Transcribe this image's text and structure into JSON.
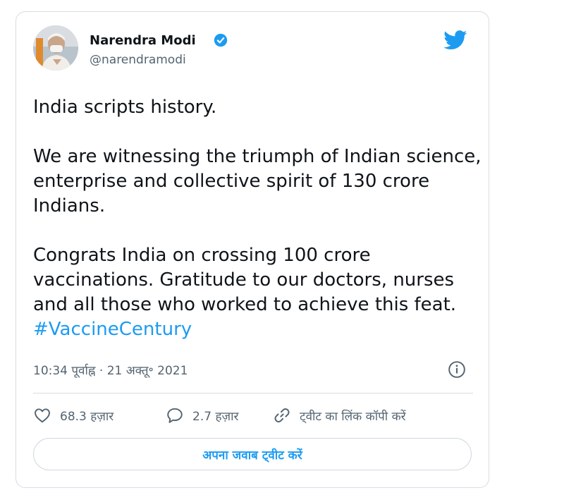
{
  "author": {
    "name": "Narendra Modi",
    "handle": "@narendramodi",
    "verified": true,
    "avatar_icon": "avatar-photo"
  },
  "tweet": {
    "paragraphs": [
      "India scripts history.",
      "We are witnessing the triumph of Indian science, enterprise and collective spirit of 130 crore Indians.",
      "Congrats India on crossing 100 crore vaccinations. Gratitude to our doctors, nurses and all those who worked to achieve this feat."
    ],
    "hashtag": "#VaccineCentury",
    "timestamp": "10:34 पूर्वाह्न · 21 अक्तू॰ 2021"
  },
  "actions": {
    "likes": "68.3 हज़ार",
    "replies": "2.7 हज़ार",
    "copy_link": "ट्वीट का लिंक कॉपी करें"
  },
  "reply_button": "अपना जवाब ट्वीट करें",
  "colors": {
    "accent": "#1d9bf0",
    "text": "#0f1419",
    "secondary": "#536471",
    "border": "#d6dde3"
  }
}
